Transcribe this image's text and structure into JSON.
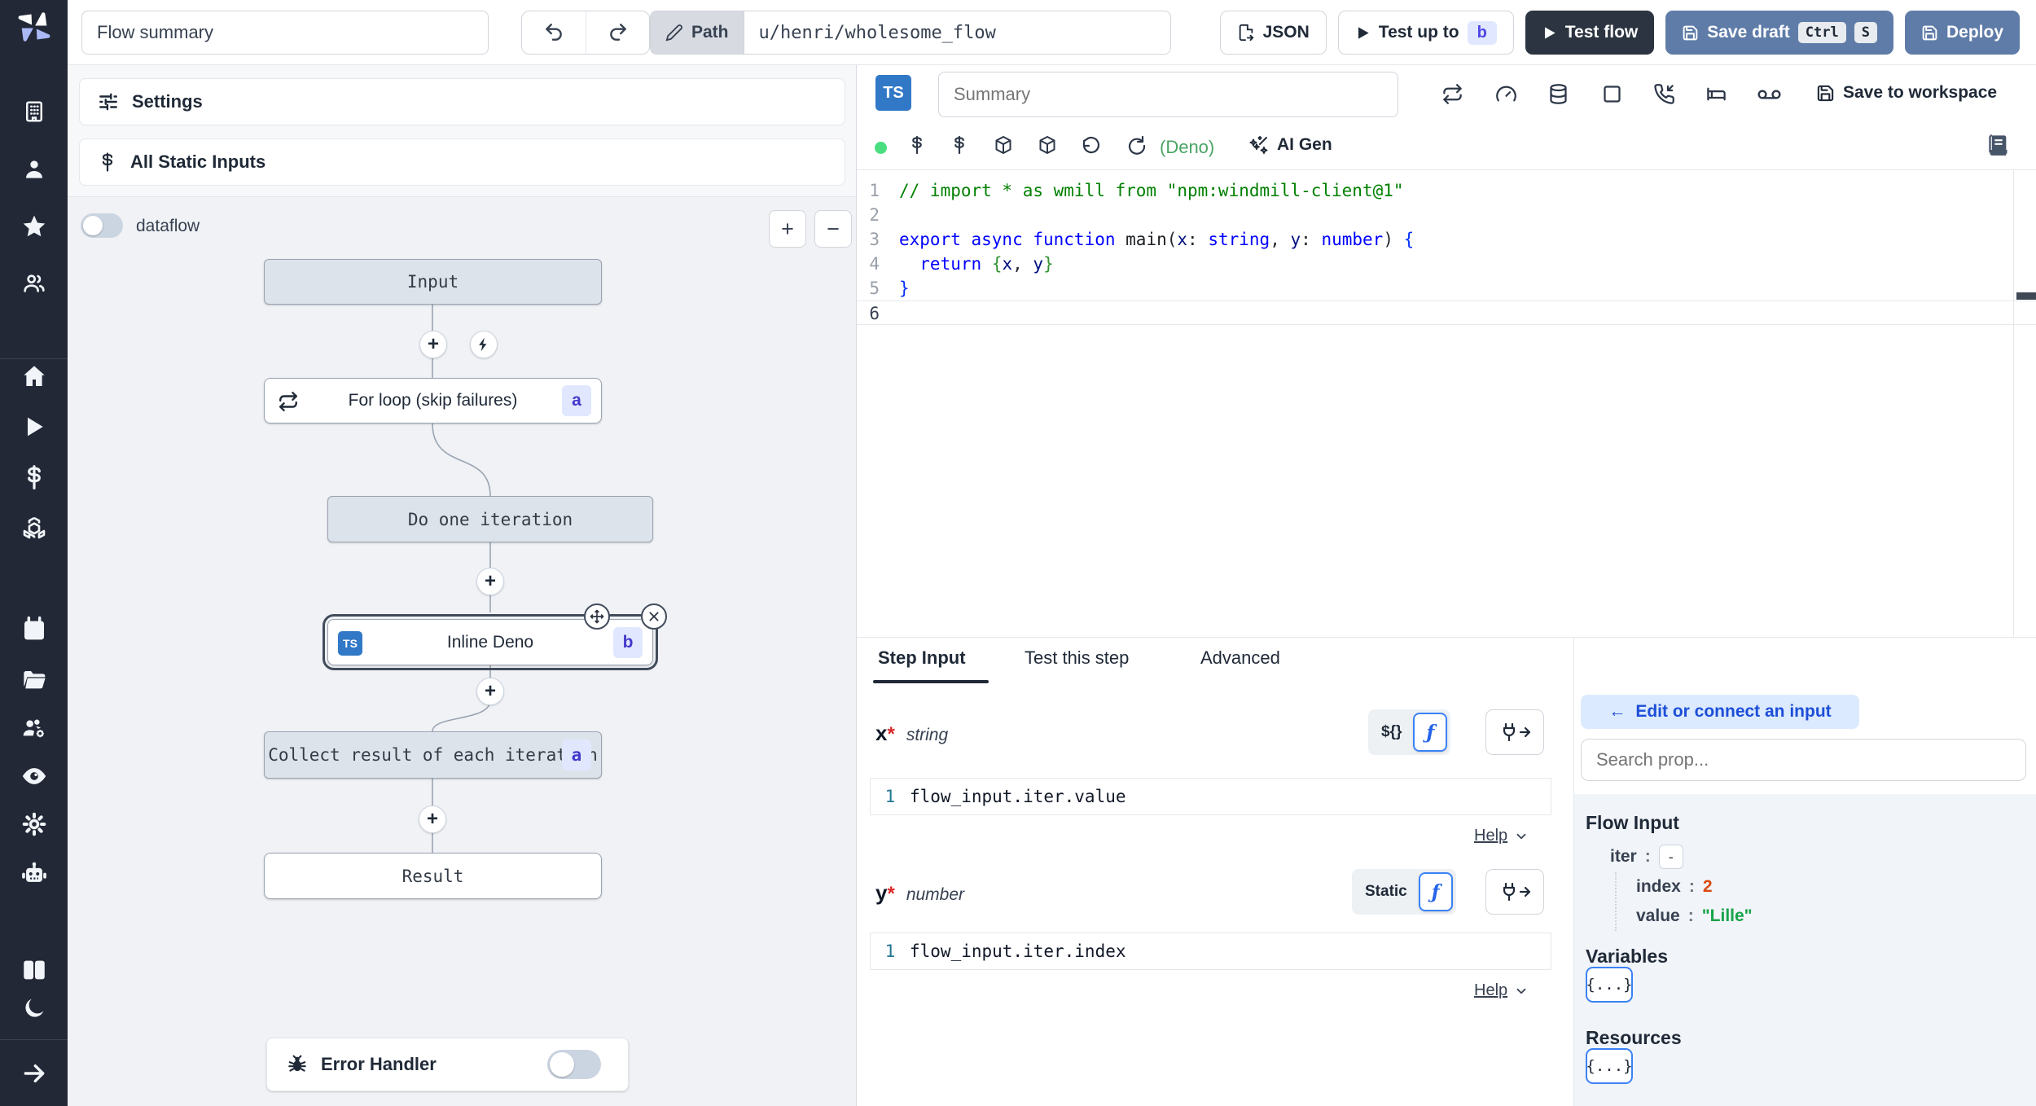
{
  "topbar": {
    "summary_value": "Flow summary",
    "path_label": "Path",
    "path_value": "u/henri/wholesome_flow",
    "json_label": "JSON",
    "test_up_to_label": "Test up to",
    "test_up_to_badge": "b",
    "test_flow_label": "Test flow",
    "save_draft_label": "Save draft",
    "kbd_ctrl": "Ctrl",
    "kbd_s": "S",
    "deploy_label": "Deploy"
  },
  "flow_panel": {
    "settings_label": "Settings",
    "static_inputs_label": "All Static Inputs",
    "dataflow_label": "dataflow",
    "zoom_in": "+",
    "zoom_out": "−",
    "nodes": {
      "input": "Input",
      "forloop": "For loop (skip failures)",
      "forloop_badge": "a",
      "iteration": "Do one iteration",
      "inline_lang": "TS",
      "inline": "Inline Deno",
      "inline_badge": "b",
      "collect": "Collect result of each iteration",
      "collect_badge": "a",
      "result": "Result"
    },
    "error_handler_label": "Error Handler"
  },
  "editor": {
    "lang_badge": "TS",
    "summary_placeholder": "Summary",
    "save_to_workspace_label": "Save to workspace",
    "runtime_label": "(Deno)",
    "ai_gen_label": "AI Gen",
    "code_lines": [
      {
        "n": 1,
        "tokens": [
          {
            "c": "cm",
            "t": "// import * as wmill from \"npm:windmill-client@1\""
          }
        ]
      },
      {
        "n": 2,
        "tokens": []
      },
      {
        "n": 3,
        "tokens": [
          {
            "c": "k",
            "t": "export async function"
          },
          {
            "c": "fn",
            "t": " main"
          },
          {
            "c": "p",
            "t": "("
          },
          {
            "c": "id",
            "t": "x"
          },
          {
            "c": "p",
            "t": ": "
          },
          {
            "c": "k",
            "t": "string"
          },
          {
            "c": "p",
            "t": ", "
          },
          {
            "c": "id",
            "t": "y"
          },
          {
            "c": "p",
            "t": ": "
          },
          {
            "c": "k",
            "t": "number"
          },
          {
            "c": "p",
            "t": ") "
          },
          {
            "c": "b1",
            "t": "{"
          }
        ]
      },
      {
        "n": 4,
        "tokens": [
          {
            "c": "k",
            "t": "  return"
          },
          {
            "c": "p",
            "t": " "
          },
          {
            "c": "b2",
            "t": "{"
          },
          {
            "c": "id",
            "t": "x"
          },
          {
            "c": "p",
            "t": ", "
          },
          {
            "c": "id",
            "t": "y"
          },
          {
            "c": "b2",
            "t": "}"
          }
        ]
      },
      {
        "n": 5,
        "tokens": [
          {
            "c": "b1",
            "t": "}"
          }
        ]
      },
      {
        "n": 6,
        "tokens": [],
        "current": true
      }
    ]
  },
  "step_panel": {
    "tabs": [
      "Step Input",
      "Test this step",
      "Advanced"
    ],
    "active_tab": "Step Input",
    "fields": {
      "x": {
        "name": "x",
        "required_mark": "*",
        "type": "string",
        "toggle_expr": "${}",
        "toggle_fn": "ƒ",
        "line_no": "1",
        "value": "flow_input.iter.value",
        "help_label": "Help"
      },
      "y": {
        "name": "y",
        "required_mark": "*",
        "type": "number",
        "toggle_static": "Static",
        "toggle_fn": "ƒ",
        "line_no": "1",
        "value": "flow_input.iter.index",
        "help_label": "Help"
      }
    }
  },
  "connect_panel": {
    "back_arrow": "←",
    "edit_label": "Edit or connect an input",
    "search_placeholder": "Search prop...",
    "flow_input_title": "Flow Input",
    "tree": {
      "iter_key": "iter",
      "colon": ":",
      "iter_toggle": "-",
      "index_key": "index",
      "index_value": "2",
      "value_key": "value",
      "value_value": "\"Lille\""
    },
    "variables_title": "Variables",
    "variables_button": "{...}",
    "resources_title": "Resources",
    "resources_button": "{...}"
  },
  "colors": {
    "sidebar_bg": "#222836",
    "ts_blue": "#3178c6",
    "steel_button": "#5f7ca8",
    "dark_button": "#2b3440",
    "badge_bg": "#e0e7ff",
    "badge_text": "#4f46e5",
    "status_green": "#4ade80",
    "deno_green": "#4aa564",
    "index_orange": "#d9480f",
    "value_green": "#16a34a",
    "link_blue": "#1d4ed8",
    "pill_bg": "#dbeafe"
  },
  "icons": {
    "windmill-logo": "three-blade pinwheel",
    "building-icon": "building",
    "user-icon": "person",
    "star-icon": "star",
    "user-group-icon": "two people",
    "home-icon": "house",
    "play-icon": "triangle",
    "dollar-icon": "$",
    "boxes-icon": "stacked cubes",
    "calendar-icon": "calendar",
    "folder-icon": "folder",
    "user-cog-icon": "people+gear",
    "eye-icon": "eye",
    "gear-icon": "gear",
    "robot-icon": "robot head",
    "book-icon": "book pair",
    "moon-icon": "crescent",
    "expand-icon": "→",
    "undo-icon": "↶",
    "redo-icon": "↷",
    "pencil-icon": "✎",
    "file-json-icon": "file export",
    "save-icon": "floppy",
    "repeat-icon": "loop arrows",
    "gauge-icon": "speedometer",
    "database-icon": "cylinder",
    "square-icon": "□",
    "phone-icon": "phone incoming",
    "bed-icon": "bed",
    "voicemail-icon": "oo",
    "dollar-small-icon": "$",
    "package-icon": "cube",
    "reset-icon": "↺",
    "reload-icon": "⟳",
    "sparkles-icon": "wand + sparkle",
    "library-icon": "closed book",
    "plus-icon": "+",
    "minus-icon": "−",
    "lightning-icon": "bolt",
    "move-icon": "✥",
    "close-icon": "✕",
    "bug-icon": "bug",
    "sliders-icon": "sliders",
    "plug-icon": "plug→",
    "chevron-down-icon": "⌄",
    "green-dot": "●"
  }
}
